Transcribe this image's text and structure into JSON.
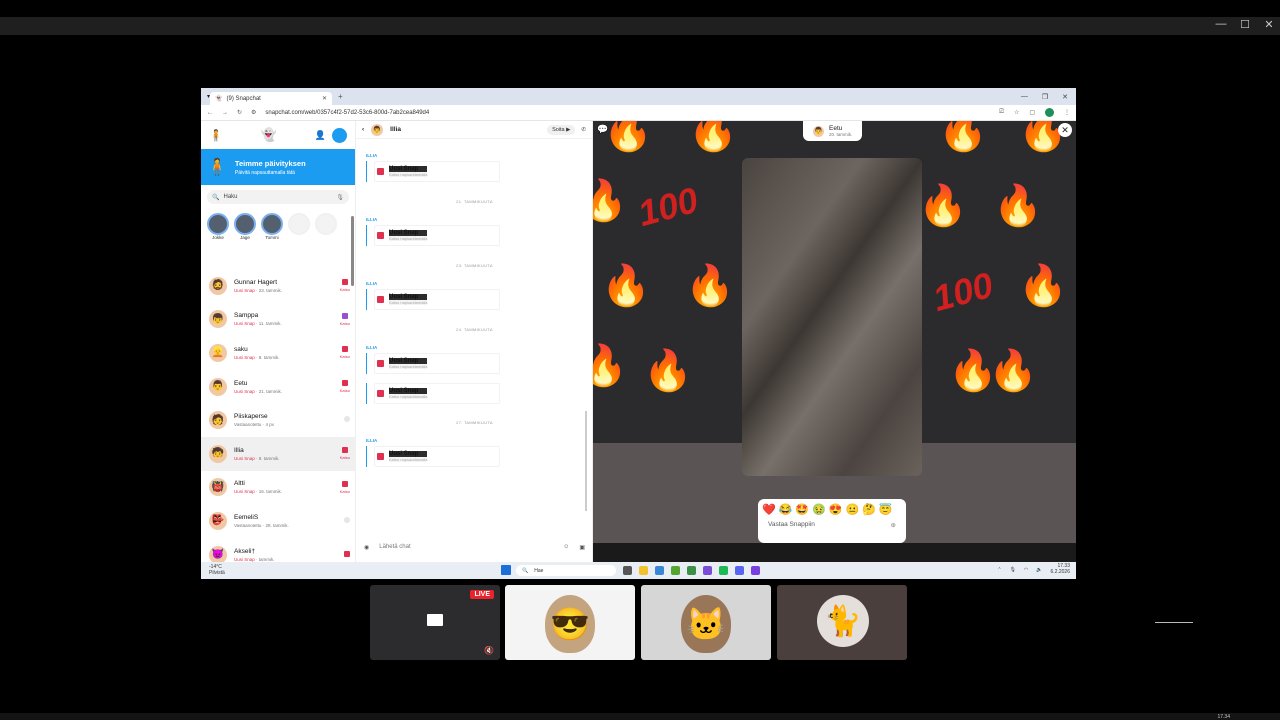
{
  "browser": {
    "tab_title": "(9) Snapchat",
    "url": "snapchat.com/web/0357c4f2-57d2-53c6-800d-7ab2cea849d4"
  },
  "sidebar": {
    "banner_title": "Teimme päivityksen",
    "banner_sub": "Päivitä napsauttamalla tätä",
    "search_placeholder": "Haku",
    "stories": [
      {
        "label": "Jokke"
      },
      {
        "label": "Jage"
      },
      {
        "label": "Tommi"
      }
    ],
    "chats": [
      {
        "name": "Gunnar Hagert",
        "status": "Uusi Snap",
        "time": "23. tammik.",
        "action": "Katso",
        "icon": "red"
      },
      {
        "name": "Samppa",
        "status": "Uusi Snap",
        "time": "11. tammik.",
        "action": "Katso",
        "icon": "purple"
      },
      {
        "name": "saku",
        "status": "Uusi Snap",
        "time": "8. tammik.",
        "action": "Katso",
        "icon": "red"
      },
      {
        "name": "Eetu",
        "status": "Uusi Snap",
        "time": "21. tammik.",
        "action": "Katso",
        "icon": "red"
      },
      {
        "name": "Piiskaperse",
        "status": "Vastaanotettu",
        "time": "4 pv",
        "action": "",
        "icon": "grey"
      },
      {
        "name": "Illia",
        "status": "Uusi Snap",
        "time": "9. tammik.",
        "action": "Katso",
        "icon": "red"
      },
      {
        "name": "Altti",
        "status": "Uusi Snap",
        "time": "16. tammik.",
        "action": "Katso",
        "icon": "red"
      },
      {
        "name": "EemeliS",
        "status": "Vastaanotettu",
        "time": "28. tammik.",
        "action": "",
        "icon": "grey"
      },
      {
        "name": "Akseli†",
        "status": "Uusi Snap",
        "time": "tammik.",
        "action": "",
        "icon": "red"
      }
    ]
  },
  "chat": {
    "name": "Illia",
    "call_label": "Soita",
    "sender": "ILLIA",
    "snap_title": "Uusi Snap",
    "snap_sub": "Katso napsauttamalla",
    "dates": [
      "21. TAMMIKUUTA",
      "23. TAMMIKUUTA",
      "24. TAMMIKUUTA",
      "27. TAMMIKUUTA"
    ],
    "compose_placeholder": "Lähetä chat"
  },
  "viewer": {
    "sender_name": "Eetu",
    "sender_time": "20. tammik.",
    "reply_placeholder": "Vastaa Snappiin",
    "emojis": [
      "❤️",
      "😂",
      "🤩",
      "🤢",
      "😍",
      "😐",
      "🤔",
      "😇"
    ]
  },
  "taskbar": {
    "weather_temp": "-14°C",
    "weather_desc": "Pilvistä",
    "search": "Hae",
    "time": "17.33",
    "date": "6.2.2026"
  },
  "call": {
    "live_label": "LIVE",
    "bottom_time": "17.34"
  }
}
